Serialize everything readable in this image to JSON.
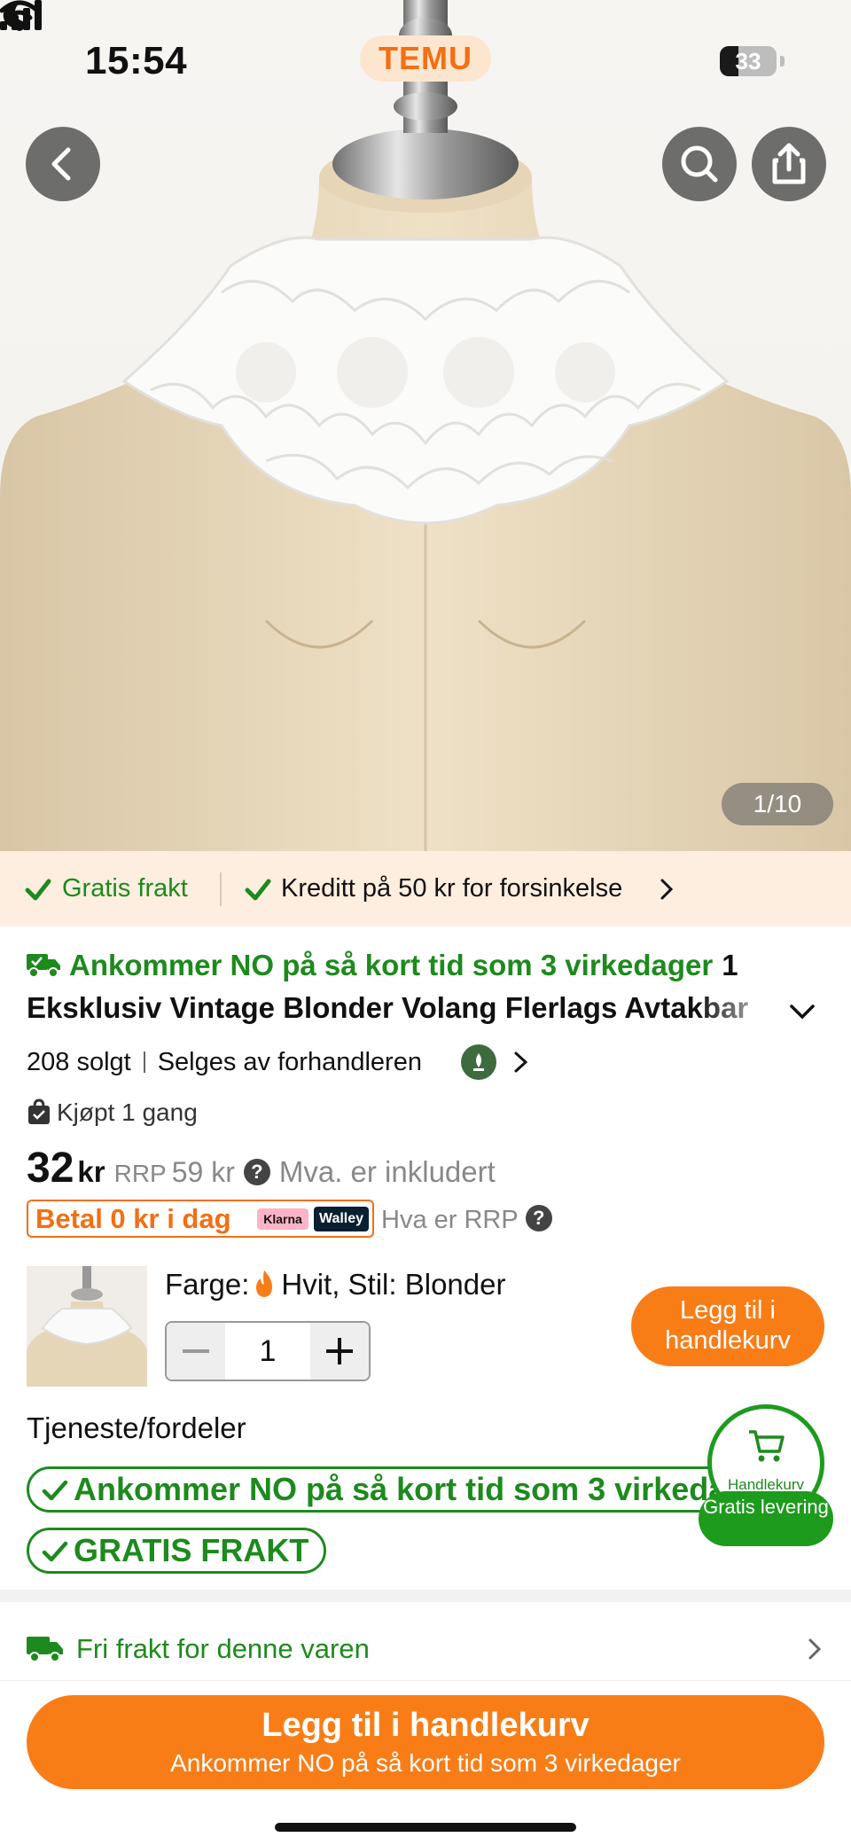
{
  "status_bar": {
    "time": "15:54",
    "battery": "33",
    "battery_level": 0.33
  },
  "brand": "TEMU",
  "hero": {
    "image_counter": "1/10"
  },
  "benefits_strip": {
    "free_shipping": "Gratis frakt",
    "credit": "Kreditt på 50 kr for forsinkelse"
  },
  "product": {
    "delivery_line": "Ankommer NO på så kort tid som 3 virkedager",
    "delivery_num": "1",
    "title": "Eksklusiv Vintage Blonder Volang Flerlags Avtakbar",
    "sold": "208 solgt",
    "seller": "Selges av forhandleren",
    "bought": "Kjøpt 1 gang",
    "price": "32",
    "currency": "kr",
    "rrp_label": "RRP",
    "rrp_value": "59 kr",
    "vat": "Mva. er inkludert",
    "pay_today": "Betal 0 kr i dag",
    "klarna": "Klarna",
    "walley": "Walley",
    "rrp_what": "Hva er RRP"
  },
  "variant": {
    "label": "Farge:",
    "value": "Hvit, Stil: Blonder",
    "quantity": "1",
    "add_button": "Legg til i handlekurv"
  },
  "services": {
    "title": "Tjeneste/fordeler",
    "pill1": "Ankommer NO på så kort tid som 3 virkedager",
    "pill2": "GRATIS FRAKT"
  },
  "cart_fab": {
    "label": "Handlekurv",
    "badge": "Gratis levering"
  },
  "free_shipping_row": "Fri frakt for denne varen",
  "bottom_cta": {
    "main": "Legg til i handlekurv",
    "sub": "Ankommer NO på så kort tid som 3 virkedager"
  },
  "colors": {
    "accent_orange": "#f97d17",
    "brand_orange": "#f36f13",
    "green": "#1d8a1d",
    "strip_bg": "#fdeee0"
  }
}
